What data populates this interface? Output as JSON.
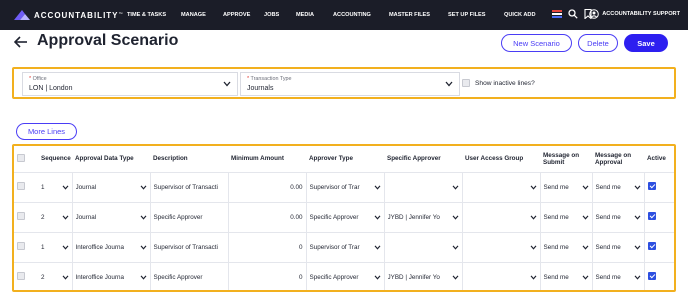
{
  "brand": {
    "name": "ACCOUNTABILITY",
    "trademark": "™"
  },
  "nav": {
    "items": [
      "TIME & TASKS",
      "MANAGE",
      "APPROVE",
      "JOBS",
      "MEDIA",
      "ACCOUNTING",
      "MASTER FILES",
      "SET UP FILES",
      "QUICK ADD"
    ]
  },
  "user": {
    "label": "ACCOUNTABILITY SUPPORT"
  },
  "page": {
    "title": "Approval Scenario"
  },
  "actions": {
    "new_scenario": "New Scenario",
    "delete": "Delete",
    "save": "Save"
  },
  "filters": {
    "office": {
      "label": "Office",
      "value": "LON | London"
    },
    "transaction_type": {
      "label": "Transaction Type",
      "value": "Journals"
    },
    "show_inactive": {
      "label": "Show inactive lines?",
      "checked": false
    }
  },
  "more_lines": "More Lines",
  "grid": {
    "headers": {
      "sequence": "Sequence",
      "approval_data_type": "Approval Data Type",
      "description": "Description",
      "minimum_amount": "Minimum Amount",
      "approver_type": "Approver Type",
      "specific_approver": "Specific Approver",
      "user_access_group": "User Access Group",
      "message_on_submit": "Message on Submit",
      "message_on_approval": "Message on Approval",
      "active": "Active"
    },
    "rows": [
      {
        "sequence": "1",
        "approval_data_type": "Journal",
        "description": "Supervisor of Transacti",
        "minimum_amount": "0.00",
        "approver_type": "Supervisor of Trar",
        "specific_approver": "",
        "user_access_group": "",
        "message_on_submit": "Send me",
        "message_on_approval": "Send me",
        "active": true
      },
      {
        "sequence": "2",
        "approval_data_type": "Journal",
        "description": "Specific Approver",
        "minimum_amount": "0.00",
        "approver_type": "Specific Approver",
        "specific_approver": "JYBD | Jennifer Yo",
        "user_access_group": "",
        "message_on_submit": "Send me",
        "message_on_approval": "Send me",
        "active": true
      },
      {
        "sequence": "1",
        "approval_data_type": "Interoffice Journa",
        "description": "Supervisor of Transacti",
        "minimum_amount": "0",
        "approver_type": "Supervisor of Trar",
        "specific_approver": "",
        "user_access_group": "",
        "message_on_submit": "Send me",
        "message_on_approval": "Send me",
        "active": true
      },
      {
        "sequence": "2",
        "approval_data_type": "Interoffice Journa",
        "description": "Specific Approver",
        "minimum_amount": "0",
        "approver_type": "Specific Approver",
        "specific_approver": "JYBD | Jennifer Yo",
        "user_access_group": "",
        "message_on_submit": "Send me",
        "message_on_approval": "Send me",
        "active": true
      }
    ]
  },
  "colors": {
    "accent": "#2d1ff0",
    "highlight_border": "#f2b01e",
    "topbar": "#1b1d28",
    "checkbox_on": "#2d4fe0"
  },
  "icons": {
    "back": "arrow-left-icon",
    "chevron": "chevron-down-icon",
    "search": "search-icon",
    "bookmark": "bookmark-icon",
    "user": "user-circle-icon",
    "flag": "flag-icon"
  }
}
